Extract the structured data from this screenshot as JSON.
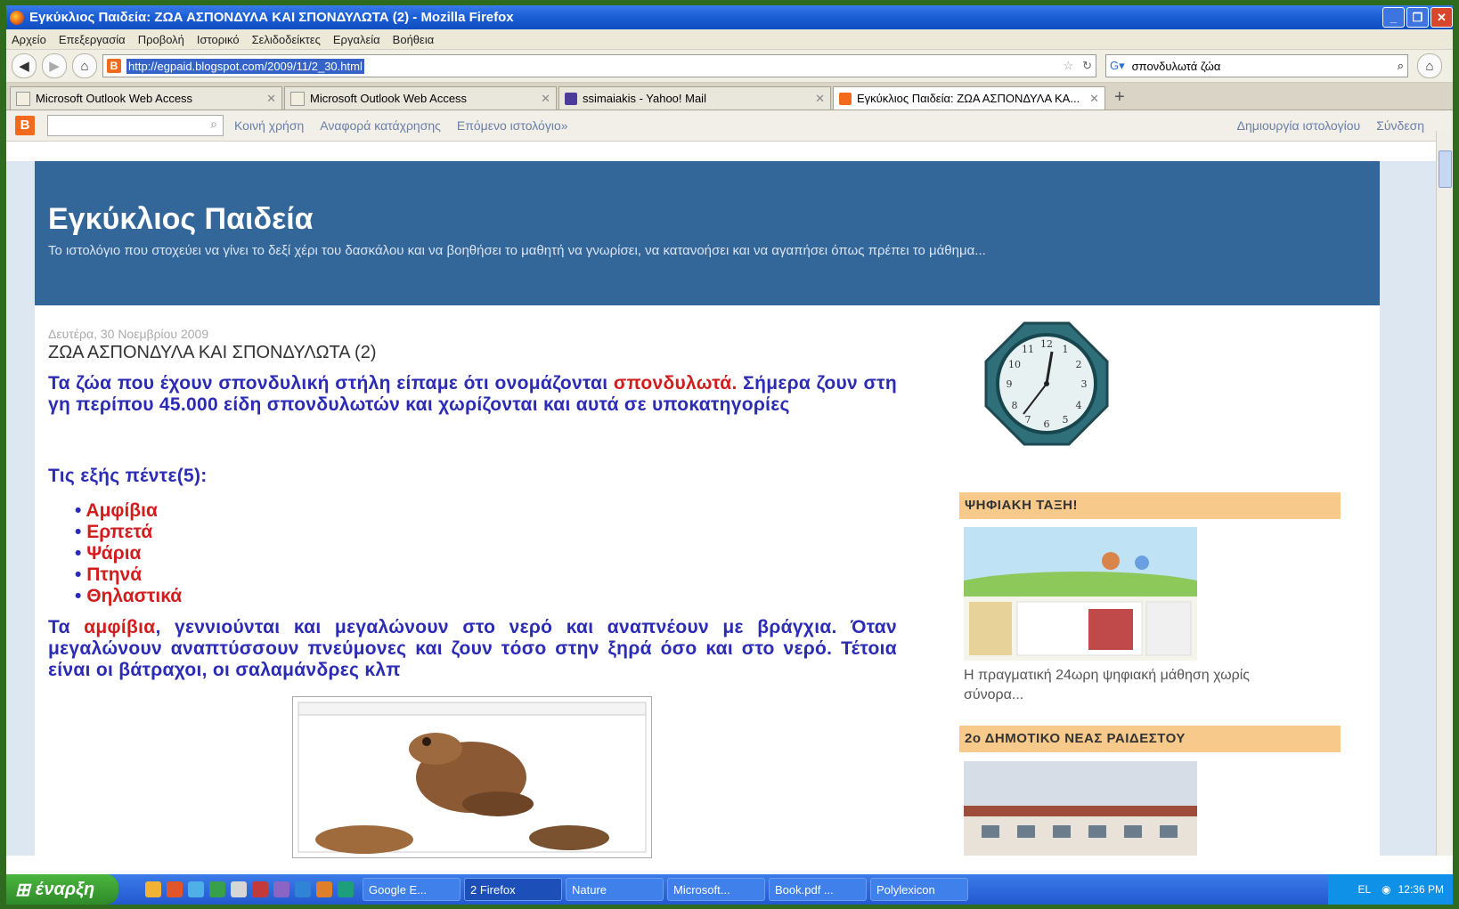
{
  "window": {
    "title": "Εγκύκλιος Παιδεία: ΖΩΑ ΑΣΠΟΝΔΥΛΑ ΚΑΙ ΣΠΟΝΔΥΛΩΤΑ (2) - Mozilla Firefox"
  },
  "menu": [
    "Αρχείο",
    "Επεξεργασία",
    "Προβολή",
    "Ιστορικό",
    "Σελιδοδείκτες",
    "Εργαλεία",
    "Βοήθεια"
  ],
  "nav": {
    "url": "http://egpaid.blogspot.com/2009/11/2_30.html",
    "search_value": "σπονδυλωτά ζώα"
  },
  "tabs": [
    {
      "label": "Microsoft Outlook Web Access"
    },
    {
      "label": "Microsoft Outlook Web Access"
    },
    {
      "label": "ssimaiakis - Yahoo! Mail"
    },
    {
      "label": "Εγκύκλιος Παιδεία: ΖΩΑ ΑΣΠΟΝΔΥΛΑ ΚΑ..."
    }
  ],
  "blogger_bar": {
    "share": "Κοινή χρήση",
    "report": "Αναφορά κατάχρησης",
    "next": "Επόμενο ιστολόγιο»",
    "create": "Δημιουργία ιστολογίου",
    "signin": "Σύνδεση"
  },
  "blog": {
    "title": "Εγκύκλιος Παιδεία",
    "description": "Το ιστολόγιο που στοχεύει να γίνει το δεξί χέρι του δασκάλου και να βοηθήσει το μαθητή να γνωρίσει, να κατανοήσει και να αγαπήσει όπως πρέπει το μάθημα..."
  },
  "post": {
    "date": "Δευτέρα, 30 Νοεμβρίου 2009",
    "title": "ΖΩΑ ΑΣΠΟΝΔΥΛΑ ΚΑΙ ΣΠΟΝΔΥΛΩΤΑ (2)",
    "p1_a": "Τα ζώα που έχουν σπονδυλική στήλη είπαμε ότι ονομάζονται ",
    "p1_red": "σπονδυλωτά.",
    "p1_b": " Σήμερα ζουν στη γη περίπου 45.000 είδη σπονδυλωτών και χωρίζονται και αυτά σε υποκατηγορίες",
    "p2": "Τις εξής πέντε(5):",
    "list": [
      "Αμφίβια",
      "Ερπετά",
      "Ψάρια",
      "Πτηνά",
      "Θηλαστικά"
    ],
    "p3_a": "Τα ",
    "p3_red": "αμφίβια",
    "p3_b": ", γεννιούνται και μεγαλώνουν στο νερό και αναπνέουν με βράγχια. Όταν μεγαλώνουν αναπτύσσουν πνεύμονες και ζουν τόσο στην ξηρά όσο και στο νερό. Τέτοια είναι οι βάτραχοι, οι σαλαμάνδρες κλπ"
  },
  "sidebar": {
    "widget1_title": "ΨΗΦΙΑΚΗ ΤΑΞΗ!",
    "widget1_caption": "Η πραγματική 24ωρη ψηφιακή μάθηση χωρίς σύνορα...",
    "widget2_title": "2ο ΔΗΜΟΤΙΚΟ ΝΕΑΣ ΡΑΙΔΕΣΤΟΥ"
  },
  "taskbar": {
    "start": "έναρξη",
    "buttons": [
      "Google E...",
      "2 Firefox",
      "Nature",
      "Microsoft...",
      "Book.pdf ...",
      "Polylexicon"
    ],
    "lang": "EL",
    "clock": "12:36 PM"
  }
}
